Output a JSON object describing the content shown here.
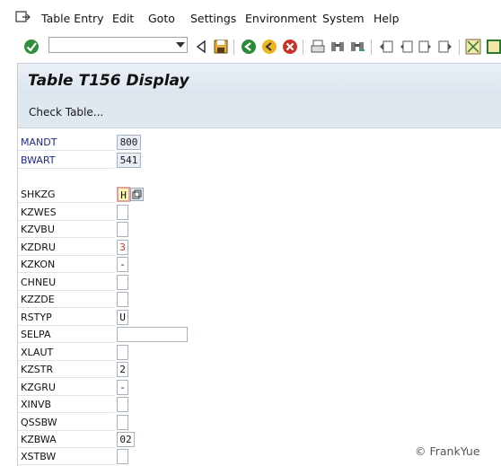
{
  "menu": {
    "items": [
      {
        "label": "Table Entry"
      },
      {
        "label": "Edit"
      },
      {
        "label": "Goto"
      },
      {
        "label": "Settings"
      },
      {
        "label": "Environment"
      },
      {
        "label": "System"
      },
      {
        "label": "Help"
      }
    ]
  },
  "toolbar": {
    "command_field_value": "",
    "icons": [
      "enter-check-icon",
      "back-triangle-icon",
      "save-icon",
      "back-green-icon",
      "exit-yellow-icon",
      "cancel-red-icon",
      "print-icon",
      "find-icon",
      "find-next-icon",
      "first-page-icon",
      "previous-page-icon",
      "next-page-icon",
      "last-page-icon",
      "layout-icon",
      "help-icon"
    ]
  },
  "screen": {
    "title": "Table T156 Display",
    "app_button": "Check Table..."
  },
  "fields": [
    {
      "name": "MANDT",
      "value": "800"
    },
    {
      "name": "BWART",
      "value": "541"
    },
    {
      "name": "SHKZG",
      "value": "H"
    },
    {
      "name": "KZWES",
      "value": ""
    },
    {
      "name": "KZVBU",
      "value": ""
    },
    {
      "name": "KZDRU",
      "value": "3"
    },
    {
      "name": "KZKON",
      "value": "-"
    },
    {
      "name": "CHNEU",
      "value": ""
    },
    {
      "name": "KZZDE",
      "value": ""
    },
    {
      "name": "RSTYP",
      "value": "U"
    },
    {
      "name": "SELPA",
      "value": ""
    },
    {
      "name": "XLAUT",
      "value": ""
    },
    {
      "name": "KZSTR",
      "value": "2"
    },
    {
      "name": "KZGRU",
      "value": "-"
    },
    {
      "name": "XINVB",
      "value": ""
    },
    {
      "name": "QSSBW",
      "value": ""
    },
    {
      "name": "KZBWA",
      "value": "02"
    },
    {
      "name": "XSTBW",
      "value": ""
    }
  ],
  "watermark": "© FrankYue",
  "colors": {
    "title_bg": "#dce5ee",
    "app_bg": "#dfe7ef",
    "key_label": "#1f2a8c",
    "key_field_bg": "#e6eff7",
    "focus_bg": "#fff7b2"
  }
}
